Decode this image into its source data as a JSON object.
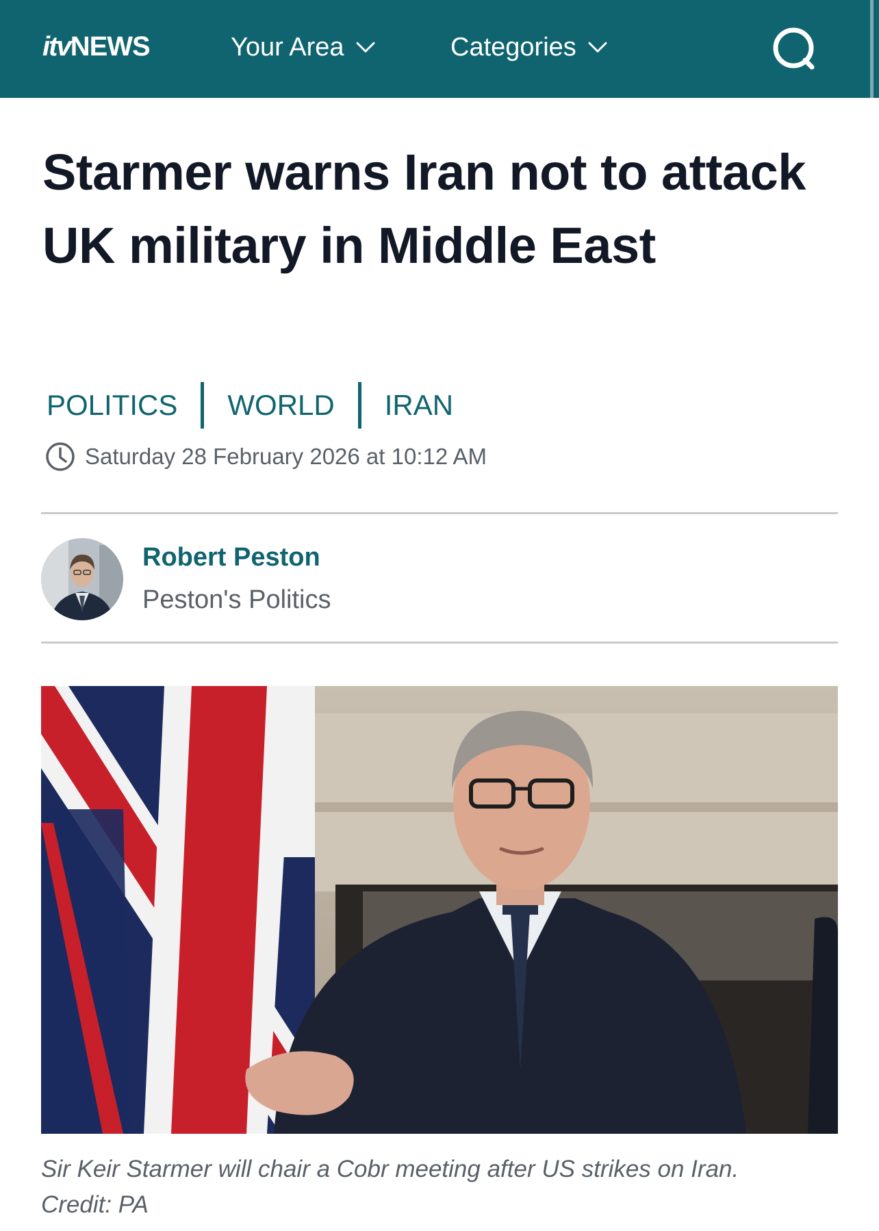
{
  "header": {
    "logo_itv": "itv",
    "logo_news": "NEWS",
    "nav": [
      {
        "label": "Your Area"
      },
      {
        "label": "Categories"
      }
    ],
    "search_icon": "search-icon",
    "background": "#10646f"
  },
  "article": {
    "headline": "Starmer warns Iran not to attack UK military in Middle East",
    "tags": [
      "POLITICS",
      "WORLD",
      "IRAN"
    ],
    "timestamp": "Saturday 28 February 2026 at 10:12 AM",
    "author": {
      "name": "Robert Peston",
      "column": "Peston's Politics"
    },
    "image_caption": "Sir Keir Starmer will chair a Cobr meeting after US strikes on Iran.",
    "image_credit": "Credit: PA"
  },
  "colors": {
    "accent": "#10646f",
    "headline": "#121826",
    "muted": "#5a6068"
  }
}
